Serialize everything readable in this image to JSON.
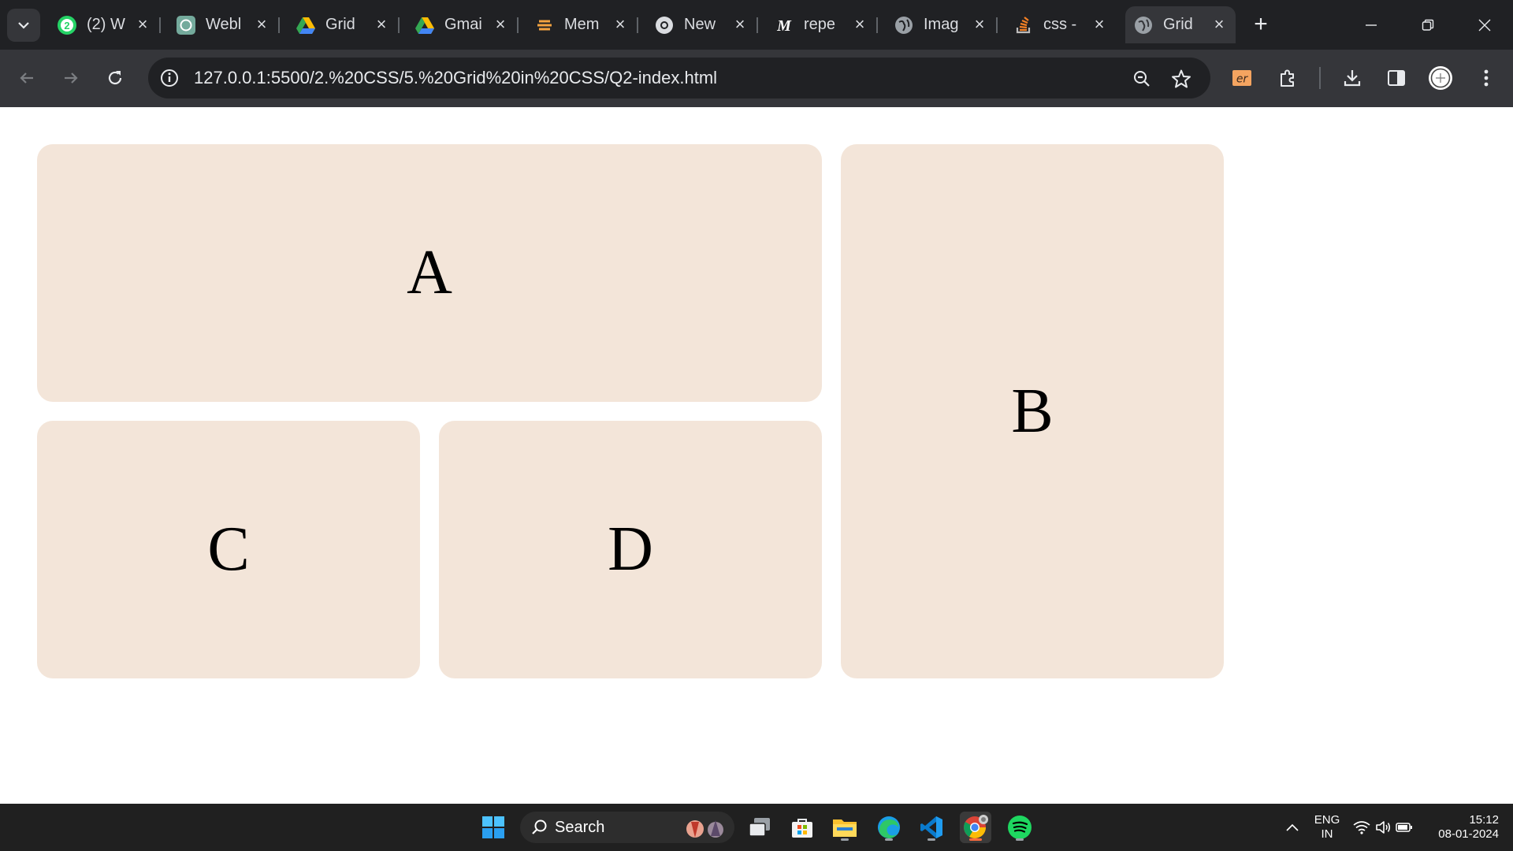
{
  "browser": {
    "tabs": [
      {
        "title": "(2) W",
        "icon": "whatsapp-icon",
        "badge": "2",
        "active": false
      },
      {
        "title": "Webl",
        "icon": "chatgpt-icon",
        "active": false
      },
      {
        "title": "Grid",
        "icon": "google-drive-icon",
        "active": false
      },
      {
        "title": "Gmai",
        "icon": "google-drive-icon",
        "active": false
      },
      {
        "title": "Mem",
        "icon": "memory-icon",
        "active": false
      },
      {
        "title": "New",
        "icon": "chrome-icon",
        "active": false
      },
      {
        "title": "repe",
        "icon": "medium-icon",
        "active": false
      },
      {
        "title": "Imag",
        "icon": "globe-icon",
        "active": false
      },
      {
        "title": "css -",
        "icon": "stackoverflow-icon",
        "active": false
      },
      {
        "title": "Grid",
        "icon": "globe-icon",
        "active": true
      }
    ],
    "url": "127.0.0.1:5500/2.%20CSS/5.%20Grid%20in%20CSS/Q2-index.html",
    "extension_label": "er"
  },
  "page": {
    "cells": {
      "a": "A",
      "b": "B",
      "c": "C",
      "d": "D"
    }
  },
  "taskbar": {
    "search_label": "Search",
    "language": "ENG",
    "region": "IN",
    "time": "15:12",
    "date": "08-01-2024"
  },
  "colors": {
    "cell_background": "#f3e5d9",
    "tabstrip": "#202124",
    "toolbar": "#35363a",
    "taskbar": "#202020"
  }
}
